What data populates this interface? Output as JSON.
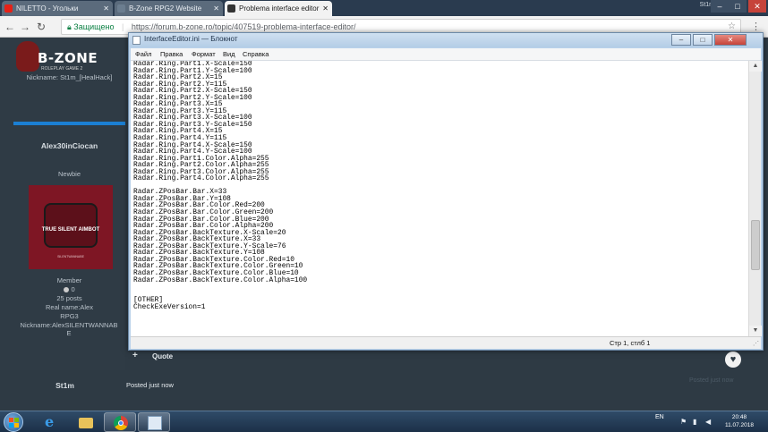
{
  "browser": {
    "tabs": [
      {
        "label": "NILETTO - Угольки",
        "favicon_color": "#e62117",
        "active": false
      },
      {
        "label": "B-Zone RPG2 Website",
        "favicon_color": "#6b7d8f",
        "active": false
      },
      {
        "label": "Problema interface editor",
        "favicon_color": "#333333",
        "active": true
      }
    ],
    "user": "St1m",
    "address": {
      "security_label": "Защищено",
      "url": "https://forum.b-zone.ro/topic/407519-problema-interface-editor/"
    }
  },
  "forum": {
    "logo": {
      "brand": "B-ZONE",
      "tagline": "ROLEPLAY GAME 2"
    },
    "top_user": {
      "nickname_line": "Nickname: St1m_[HealHack]"
    },
    "poster": {
      "name": "Alex30inCiocan",
      "rank": "Newbie",
      "avatar_text": "TRUE SILENT AIMBOT",
      "avatar_footer": "SILENTWANNABE",
      "group": "Member",
      "reputation": "0",
      "posts": "25 posts",
      "real_name": "Real name:Alex",
      "server": "RPG3",
      "nickname": "Nickname:AlexSILENTWANNABE"
    },
    "actions": {
      "plus": "+",
      "quote": "Quote"
    },
    "reply": {
      "author": "St1m",
      "status": "Posted just now",
      "faint": "Posted just now"
    }
  },
  "notepad": {
    "title": "InterfaceEditor.ini — Блокнот",
    "menu": [
      "Файл",
      "Правка",
      "Формат",
      "Вид",
      "Справка"
    ],
    "lines": [
      "Radar.Ring.Part1.X-Scale=150",
      "Radar.Ring.Part1.Y-Scale=100",
      "Radar.Ring.Part2.X=15",
      "Radar.Ring.Part2.Y=115",
      "Radar.Ring.Part2.X-Scale=150",
      "Radar.Ring.Part2.Y-Scale=100",
      "Radar.Ring.Part3.X=15",
      "Radar.Ring.Part3.Y=115",
      "Radar.Ring.Part3.X-Scale=100",
      "Radar.Ring.Part3.Y-Scale=150",
      "Radar.Ring.Part4.X=15",
      "Radar.Ring.Part4.Y=115",
      "Radar.Ring.Part4.X-Scale=150",
      "Radar.Ring.Part4.Y-Scale=100",
      "Radar.Ring.Part1.Color.Alpha=255",
      "Radar.Ring.Part2.Color.Alpha=255",
      "Radar.Ring.Part3.Color.Alpha=255",
      "Radar.Ring.Part4.Color.Alpha=255",
      "",
      "Radar.ZPosBar.Bar.X=33",
      "Radar.ZPosBar.Bar.Y=108",
      "Radar.ZPosBar.Bar.Color.Red=200",
      "Radar.ZPosBar.Bar.Color.Green=200",
      "Radar.ZPosBar.Bar.Color.Blue=200",
      "Radar.ZPosBar.Bar.Color.Alpha=200",
      "Radar.ZPosBar.BackTexture.X-Scale=20",
      "Radar.ZPosBar.BackTexture.X=33",
      "Radar.ZPosBar.BackTexture.Y-Scale=76",
      "Radar.ZPosBar.BackTexture.Y=108",
      "Radar.ZPosBar.BackTexture.Color.Red=10",
      "Radar.ZPosBar.BackTexture.Color.Green=10",
      "Radar.ZPosBar.BackTexture.Color.Blue=10",
      "Radar.ZPosBar.BackTexture.Color.Alpha=100",
      "",
      "",
      "[OTHER]",
      "CheckExeVersion=1"
    ],
    "status_position": "Стр 1, стлб 1"
  },
  "taskbar": {
    "language": "EN",
    "time": "20:48",
    "date": "11.07.2018"
  },
  "icons": {
    "tab_close": "close-icon",
    "notepad_minimize": "minimize-icon",
    "notepad_maximize": "maximize-icon",
    "notepad_close": "close-icon",
    "heart": "heart-icon"
  }
}
